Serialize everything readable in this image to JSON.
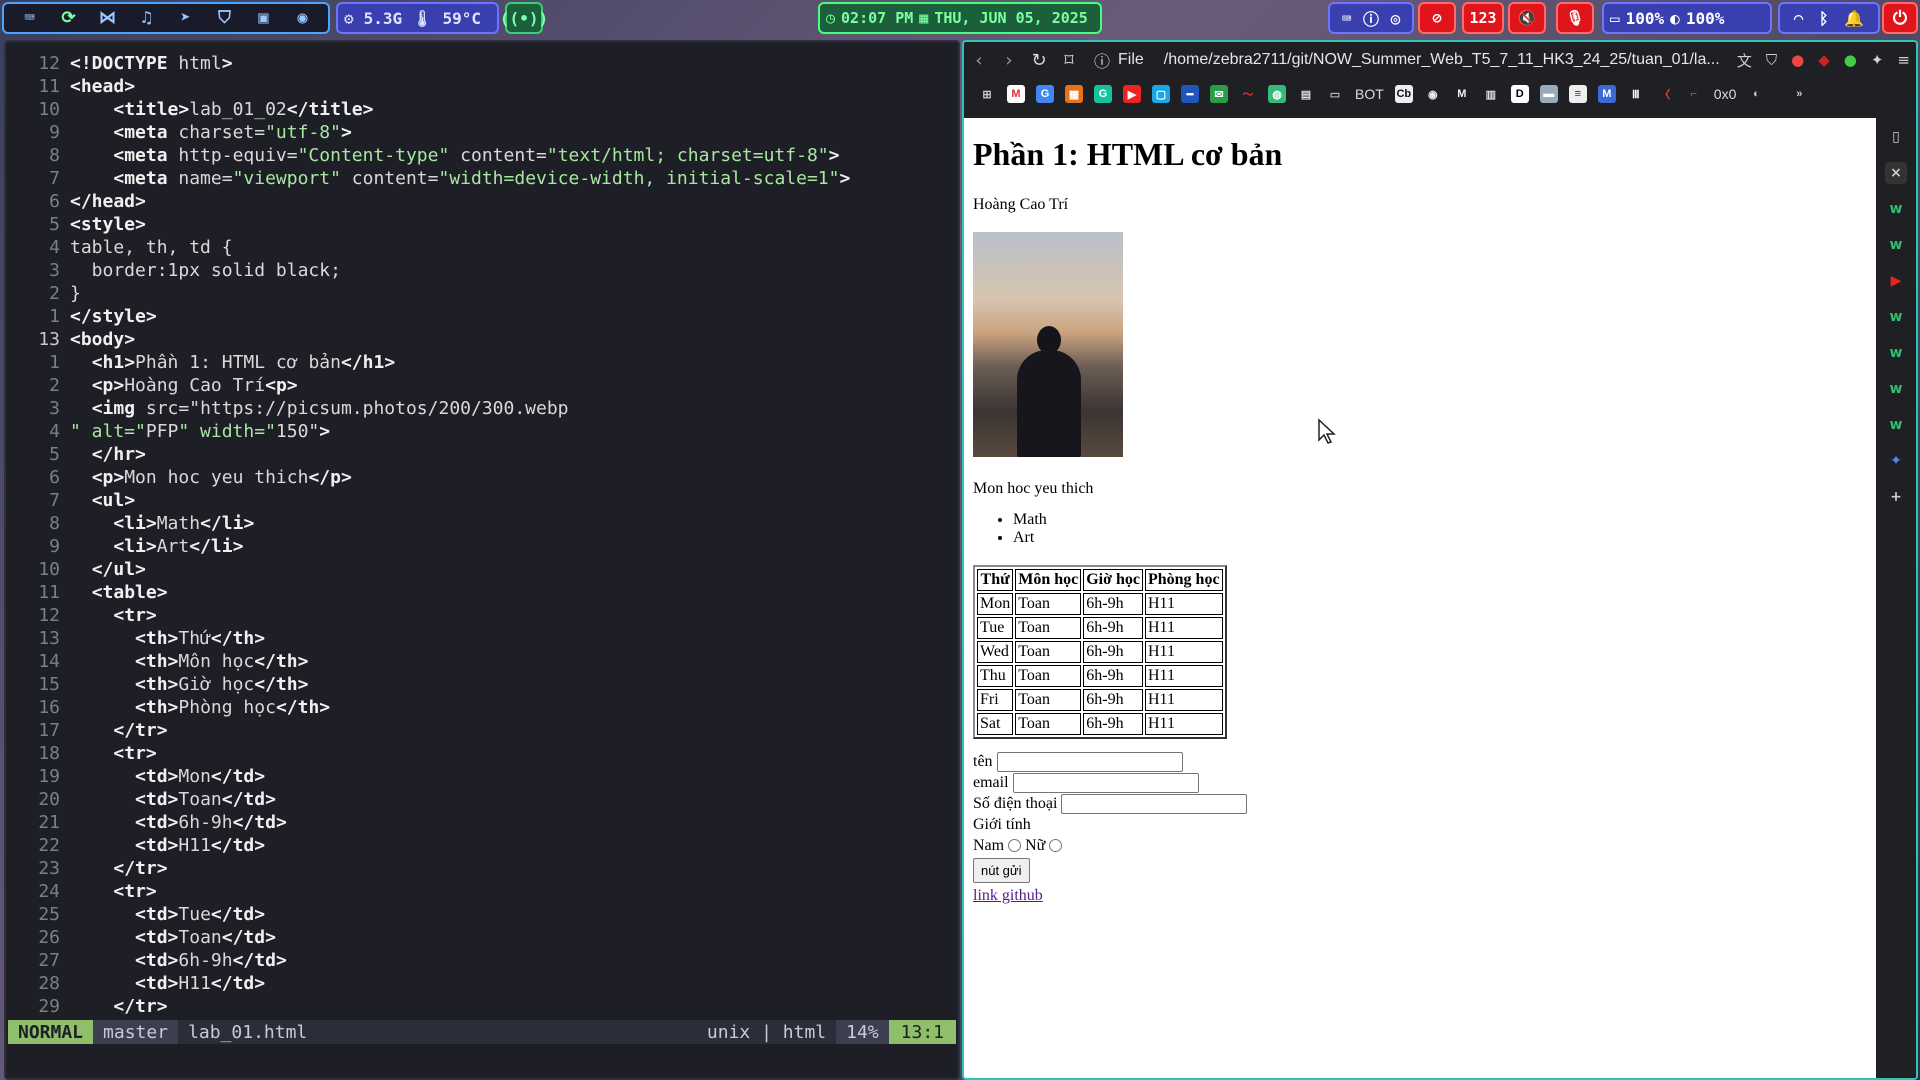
{
  "topbar": {
    "apps": [
      "terminal-icon",
      "refresh-icon",
      "vscode-icon",
      "music-icon",
      "telegram-icon",
      "shield-icon",
      "files-icon",
      "gamepad-icon"
    ],
    "sys": {
      "mem": "5.3G",
      "temp": "59°C"
    },
    "clock": {
      "time": "02:07 PM",
      "date": "THU, JUN 05, 2025"
    },
    "notif_count": "123",
    "volume": "100%",
    "brightness": "100%"
  },
  "editor": {
    "lines": [
      {
        "n": "12",
        "t": "<!DOCTYPE html>"
      },
      {
        "n": "11",
        "t": "<head>"
      },
      {
        "n": "10",
        "t": "    <title>lab_01_02</title>"
      },
      {
        "n": "9",
        "t": "    <meta charset=\"utf-8\">"
      },
      {
        "n": "8",
        "t": "    <meta http-equiv=\"Content-type\" content=\"text/html; charset=utf-8\">"
      },
      {
        "n": "7",
        "t": "    <meta name=\"viewport\" content=\"width=device-width, initial-scale=1\">"
      },
      {
        "n": "6",
        "t": "</head>"
      },
      {
        "n": "5",
        "t": "<style>"
      },
      {
        "n": "4",
        "t": "table, th, td {"
      },
      {
        "n": "3",
        "t": "  border:1px solid black;"
      },
      {
        "n": "2",
        "t": "}"
      },
      {
        "n": "1",
        "t": "</style>"
      },
      {
        "n": "13",
        "t": "<body>",
        "cur": true
      },
      {
        "n": "1",
        "t": "  <h1>Phần 1: HTML cơ bản</h1>"
      },
      {
        "n": "2",
        "t": "  <p>Hoàng Cao Trí<p>"
      },
      {
        "n": "3",
        "t": "  <img src=\"https://picsum.photos/200/300.webp"
      },
      {
        "n": "4",
        "t": "\" alt=\"PFP\" width=\"150\">"
      },
      {
        "n": "5",
        "t": "  </hr>"
      },
      {
        "n": "6",
        "t": "  <p>Mon hoc yeu thich</p>"
      },
      {
        "n": "7",
        "t": "  <ul>"
      },
      {
        "n": "8",
        "t": "    <li>Math</li>"
      },
      {
        "n": "9",
        "t": "    <li>Art</li>"
      },
      {
        "n": "10",
        "t": "  </ul>"
      },
      {
        "n": "11",
        "t": "  <table>"
      },
      {
        "n": "12",
        "t": "    <tr>"
      },
      {
        "n": "13",
        "t": "      <th>Thứ</th>"
      },
      {
        "n": "14",
        "t": "      <th>Môn học</th>"
      },
      {
        "n": "15",
        "t": "      <th>Giờ học</th>"
      },
      {
        "n": "16",
        "t": "      <th>Phòng học</th>"
      },
      {
        "n": "17",
        "t": "    </tr>"
      },
      {
        "n": "18",
        "t": "    <tr>"
      },
      {
        "n": "19",
        "t": "      <td>Mon</td>"
      },
      {
        "n": "20",
        "t": "      <td>Toan</td>"
      },
      {
        "n": "21",
        "t": "      <td>6h-9h</td>"
      },
      {
        "n": "22",
        "t": "      <td>H11</td>"
      },
      {
        "n": "23",
        "t": "    </tr>"
      },
      {
        "n": "24",
        "t": "    <tr>"
      },
      {
        "n": "25",
        "t": "      <td>Tue</td>"
      },
      {
        "n": "26",
        "t": "      <td>Toan</td>"
      },
      {
        "n": "27",
        "t": "      <td>6h-9h</td>"
      },
      {
        "n": "28",
        "t": "      <td>H11</td>"
      },
      {
        "n": "29",
        "t": "    </tr>"
      }
    ],
    "status": {
      "mode": "NORMAL",
      "branch": "master",
      "file": "lab_01.html",
      "enc": "unix | html",
      "pct": "14%",
      "pos": "13:1"
    }
  },
  "browser": {
    "scheme": "File",
    "url": "/home/zebra2711/git/NOW_Summer_Web_T5_7_11_HK3_24_25/tuan_01/la...",
    "bookmarks": {
      "bot": "BOT",
      "hex": "0x0"
    },
    "page": {
      "h1": "Phần 1: HTML cơ bản",
      "name": "Hoàng Cao Trí",
      "fav_title": "Mon hoc yeu thich",
      "fav_items": [
        "Math",
        "Art"
      ],
      "table_headers": [
        "Thứ",
        "Môn học",
        "Giờ học",
        "Phòng học"
      ],
      "table_rows": [
        [
          "Mon",
          "Toan",
          "6h-9h",
          "H11"
        ],
        [
          "Tue",
          "Toan",
          "6h-9h",
          "H11"
        ],
        [
          "Wed",
          "Toan",
          "6h-9h",
          "H11"
        ],
        [
          "Thu",
          "Toan",
          "6h-9h",
          "H11"
        ],
        [
          "Fri",
          "Toan",
          "6h-9h",
          "H11"
        ],
        [
          "Sat",
          "Toan",
          "6h-9h",
          "H11"
        ]
      ],
      "form": {
        "name_label": "tên",
        "email_label": "email",
        "phone_label": "Số điện thoại",
        "gender_label": "Giới tính",
        "male": "Nam",
        "female": "Nữ",
        "submit": "nút gửi",
        "link": "link github"
      }
    }
  }
}
